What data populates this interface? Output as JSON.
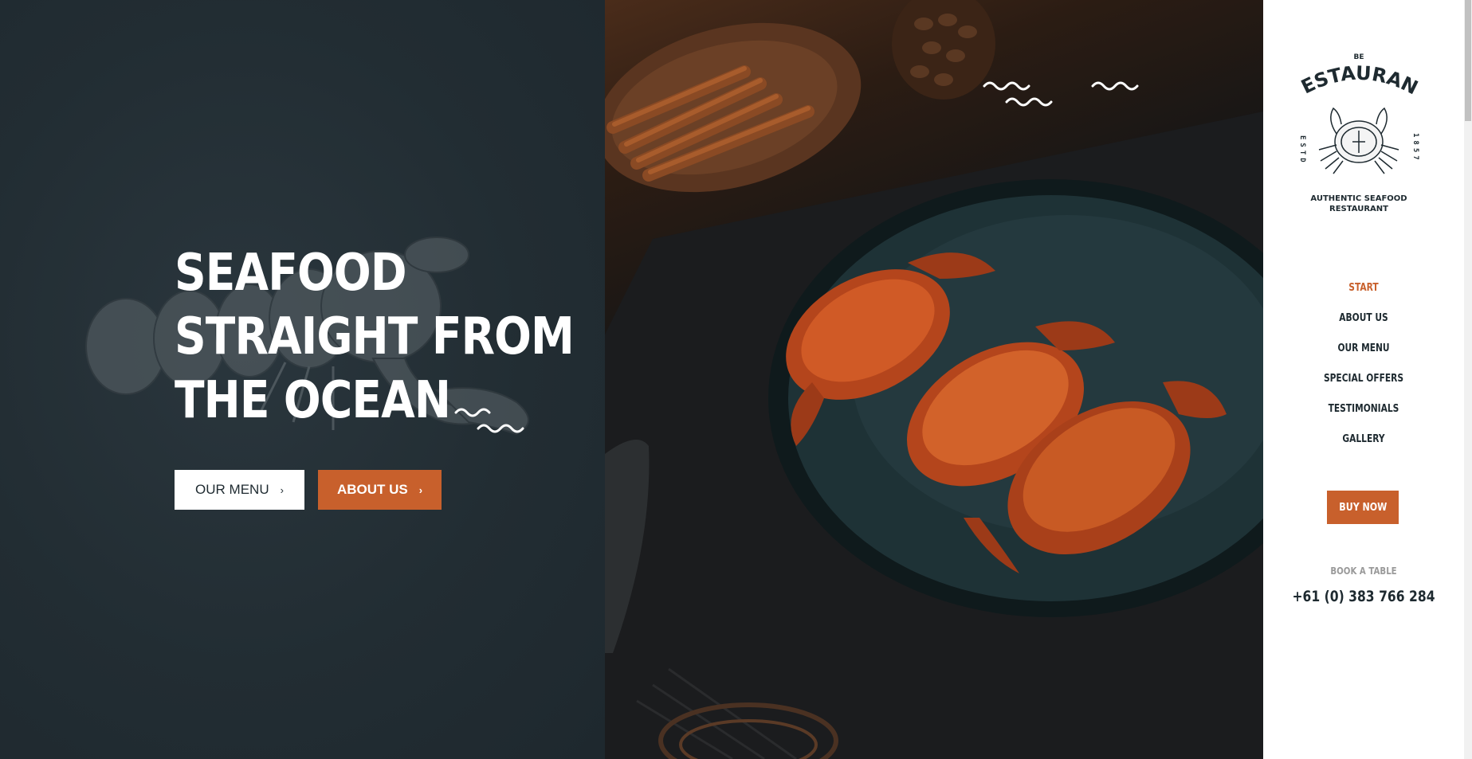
{
  "hero": {
    "title_lines": [
      "SEAFOOD",
      "STRAIGHT FROM",
      "THE OCEAN"
    ],
    "buttons": {
      "menu_label": "OUR MENU",
      "about_label": "ABOUT US",
      "chevron": "›"
    }
  },
  "logo": {
    "top_text": "BE",
    "name": "RESTAURANT",
    "estd_left": "ESTD",
    "estd_right": "1857",
    "tagline_line1": "AUTHENTIC SEAFOOD",
    "tagline_line2": "RESTAURANT",
    "icon": "crab-illustration"
  },
  "nav": {
    "items": [
      {
        "label": "START",
        "active": true
      },
      {
        "label": "ABOUT US",
        "active": false
      },
      {
        "label": "OUR MENU",
        "active": false
      },
      {
        "label": "SPECIAL OFFERS",
        "active": false
      },
      {
        "label": "TESTIMONIALS",
        "active": false
      },
      {
        "label": "GALLERY",
        "active": false
      }
    ]
  },
  "cta": {
    "buy_label": "BUY NOW",
    "book_label": "BOOK A TABLE",
    "phone": "+61 (0) 383 766 284"
  },
  "colors": {
    "accent": "#c8602c",
    "dark": "#1e2a30",
    "white": "#ffffff"
  }
}
